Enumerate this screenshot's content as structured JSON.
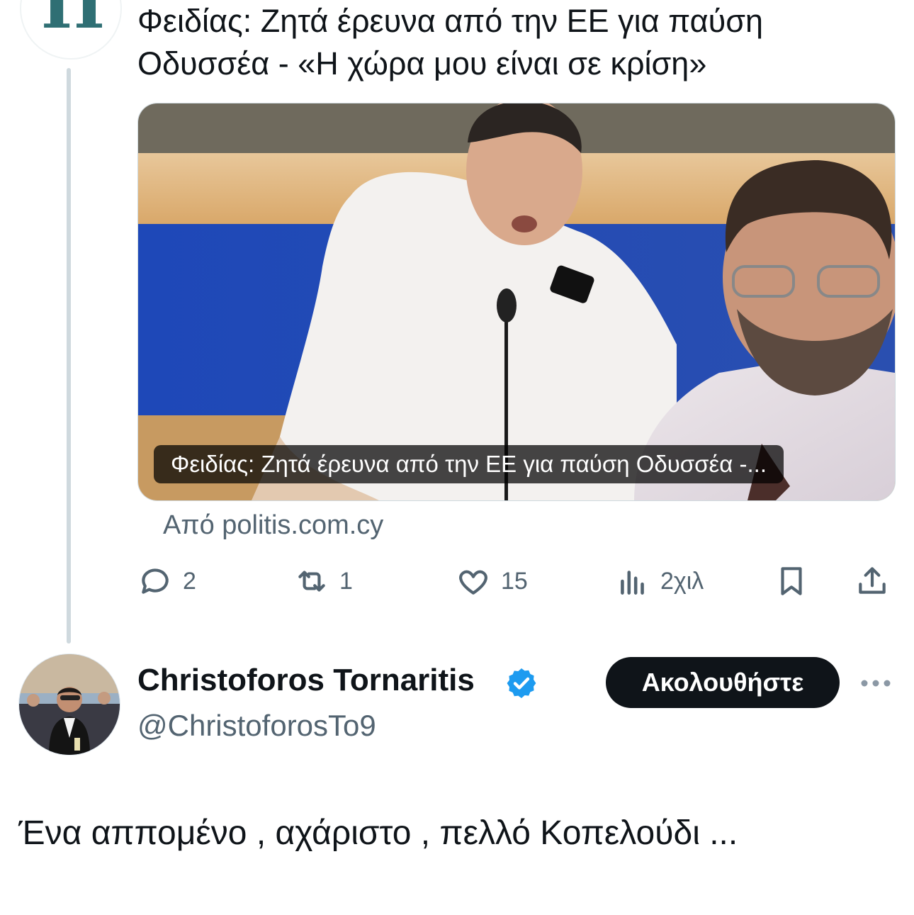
{
  "quoted_post": {
    "avatar_logo": "Π",
    "headline": "Φειδίας: Ζητά έρευνα από την ΕΕ για παύση Οδυσσέα - «Η χώρα μου είναι σε κρίση»",
    "card_caption": "Φειδίας: Ζητά έρευνα από την ΕΕ για παύση Οδυσσέα -...",
    "source": "Από politis.com.cy"
  },
  "actions": {
    "replies": "2",
    "reposts": "1",
    "likes": "15",
    "views": "2χιλ"
  },
  "icons": [
    "reply-icon",
    "repost-icon",
    "like-icon",
    "views-icon",
    "bookmark-icon",
    "share-icon",
    "verified-icon",
    "more-icon"
  ],
  "reply_post": {
    "author_name": "Christoforos Tornaritis",
    "handle": "@ChristoforosTo9",
    "follow_label": "Ακολουθήστε",
    "text": "Ένα αππομένο , αχάριστο , πελλό Κοπελούδι ..."
  },
  "colors": {
    "text": "#0f1419",
    "secondary": "#536471",
    "verified": "#1d9bf0",
    "follow_bg": "#0f1419"
  }
}
